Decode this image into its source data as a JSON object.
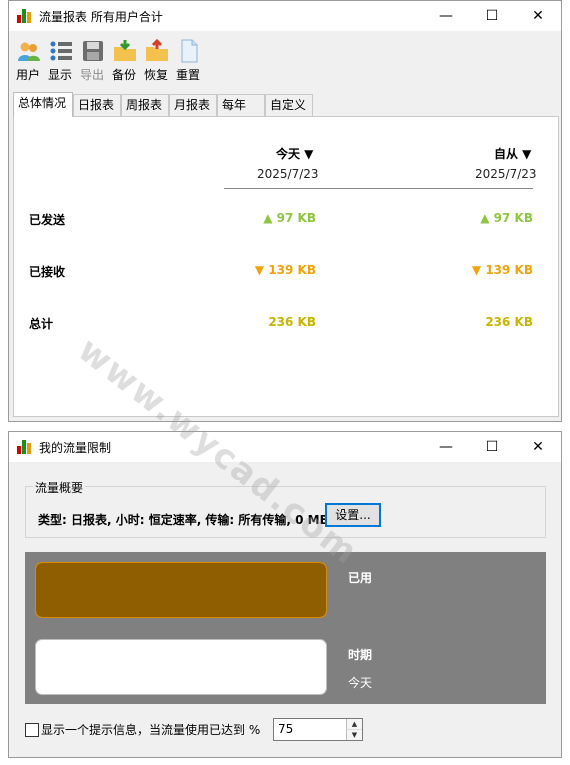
{
  "window1": {
    "title": "流量报表 所有用户合计",
    "toolbar": [
      {
        "label": "用户",
        "icon": "users-icon",
        "enabled": true
      },
      {
        "label": "显示",
        "icon": "list-icon",
        "enabled": true
      },
      {
        "label": "导出",
        "icon": "save-disk-icon",
        "enabled": false
      },
      {
        "label": "备份",
        "icon": "folder-down-icon",
        "enabled": true
      },
      {
        "label": "恢复",
        "icon": "folder-up-icon",
        "enabled": true
      },
      {
        "label": "重置",
        "icon": "document-icon",
        "enabled": true
      }
    ],
    "tabs": [
      "总体情况",
      "日报表",
      "周报表",
      "月报表",
      "每年",
      "自定义"
    ],
    "active_tab": 0,
    "columns": [
      {
        "header": "今天 ▼",
        "date": "2025/7/23"
      },
      {
        "header": "自从 ▼",
        "date": "2025/7/23"
      }
    ],
    "rows": [
      {
        "label": "已发送",
        "values": [
          "▲ 97 KB",
          "▲ 97 KB"
        ],
        "color": "#8dc63f"
      },
      {
        "label": "已接收",
        "values": [
          "▼ 139 KB",
          "▼ 139 KB"
        ],
        "color": "#f0a30a"
      },
      {
        "label": "总计",
        "values": [
          "236 KB",
          "236 KB"
        ],
        "color": "#c9b400"
      }
    ]
  },
  "window2": {
    "title": "我的流量限制",
    "group_title": "流量概要",
    "summary": "类型: 日报表, 小时: 恒定速率, 传输: 所有传输, 0 MB",
    "settings_button": "设置...",
    "used_label": "已用",
    "period_label": "时期",
    "period_value": "今天",
    "used_fill_fraction": 1.0,
    "checkbox_label": "显示一个提示信息，当流量使用已达到 %",
    "checkbox_checked": false,
    "threshold_value": "75"
  },
  "watermark": "www.wycad.com",
  "colors": {
    "gauge_fill": "#8f5e00",
    "gauge_bg": "#808080",
    "accent": "#0078d7"
  }
}
